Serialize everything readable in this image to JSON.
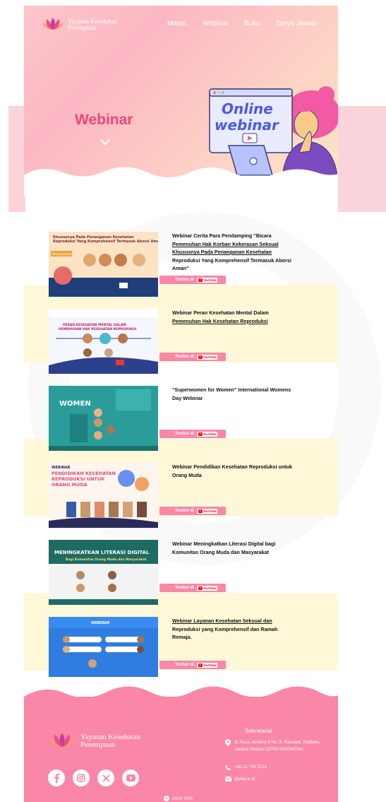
{
  "brand": {
    "name_line1": "Yayasan Kesehatan",
    "name_line2": "Perempuan"
  },
  "nav": {
    "items": [
      "Materi",
      "Webinar",
      "Buku",
      "Tanya Jawab"
    ]
  },
  "hero": {
    "title": "Webinar",
    "illustration_text_line1": "Online",
    "illustration_text_line2": "webinar"
  },
  "button": {
    "label": "Tonton di",
    "platform": "YouTube"
  },
  "webinars": [
    {
      "title_plain": "Webinar Cerita Para Pendamping \"Bicara ",
      "title_link": "Pemenuhan Hak Korban Kekerasan Seksual Khususnya Pada Penanganan Kesehatan",
      "title_tail": " Reproduksi Yang Komprehensif Termasuk Aborsi Aman\"",
      "thumb_heading": "Khususnya Pada Penanganan Kesehatan Reproduksi Yang Komprehensif Termasuk Aborsi Aman",
      "thumb_tag": "Narasumber"
    },
    {
      "title_plain": "Webinar Peran Kesehatan Mental Dalam ",
      "title_link": "Pemenuhan Hak Kesehatan Reproduksi",
      "title_tail": "",
      "thumb_heading": "PERAN KESEHATAN MENTAL DALAM PEMENUHAN HAK KESEHATAN REPRODUKSI"
    },
    {
      "title_plain": "\"Superwomen for Women\" International Womens Day Webinar",
      "title_link": "",
      "title_tail": "",
      "thumb_heading": "WOMEN"
    },
    {
      "title_plain": "Webinar Pendidikan Kesehatan Reproduksi untuk Orang Muda",
      "title_link": "",
      "title_tail": "",
      "thumb_heading": "PENDIDIKAN KESEHATAN REPRODUKSI UNTUK ORANG MUDA",
      "thumb_tag": "WEBINAR"
    },
    {
      "title_plain": "Webinar Meningkatkan Literasi Digital bagi Komunitas Orang Muda dan Masyarakat",
      "title_link": "",
      "title_tail": "",
      "thumb_heading": "MENINGKATKAN LITERASI DIGITAL",
      "thumb_tag": "Bagi Komunitas Orang Muda dan Masyarakat"
    },
    {
      "title_plain": "",
      "title_link": "Webinar Layanan Kesehatan Seksual dan",
      "title_tail": " Reproduksi yang Komprehensif dan Ramah Remaja.",
      "thumb_heading": "WEBINAR"
    }
  ],
  "footer": {
    "heading": "Sekretariat",
    "address": "Jl. Kaca Jendela II No. 9, Rawajati, Kalibata, Jakarta Selatan 12750 INDONESIA",
    "phone": "+62 21 790 2112",
    "email": "@ykp.or.id",
    "copyright": "2024 YKP",
    "socials": [
      "facebook-icon",
      "instagram-icon",
      "x-icon",
      "youtube-icon"
    ]
  },
  "colors": {
    "accent": "#f0457d",
    "pink": "#fa86a8",
    "stripe": "#fff8d8"
  }
}
